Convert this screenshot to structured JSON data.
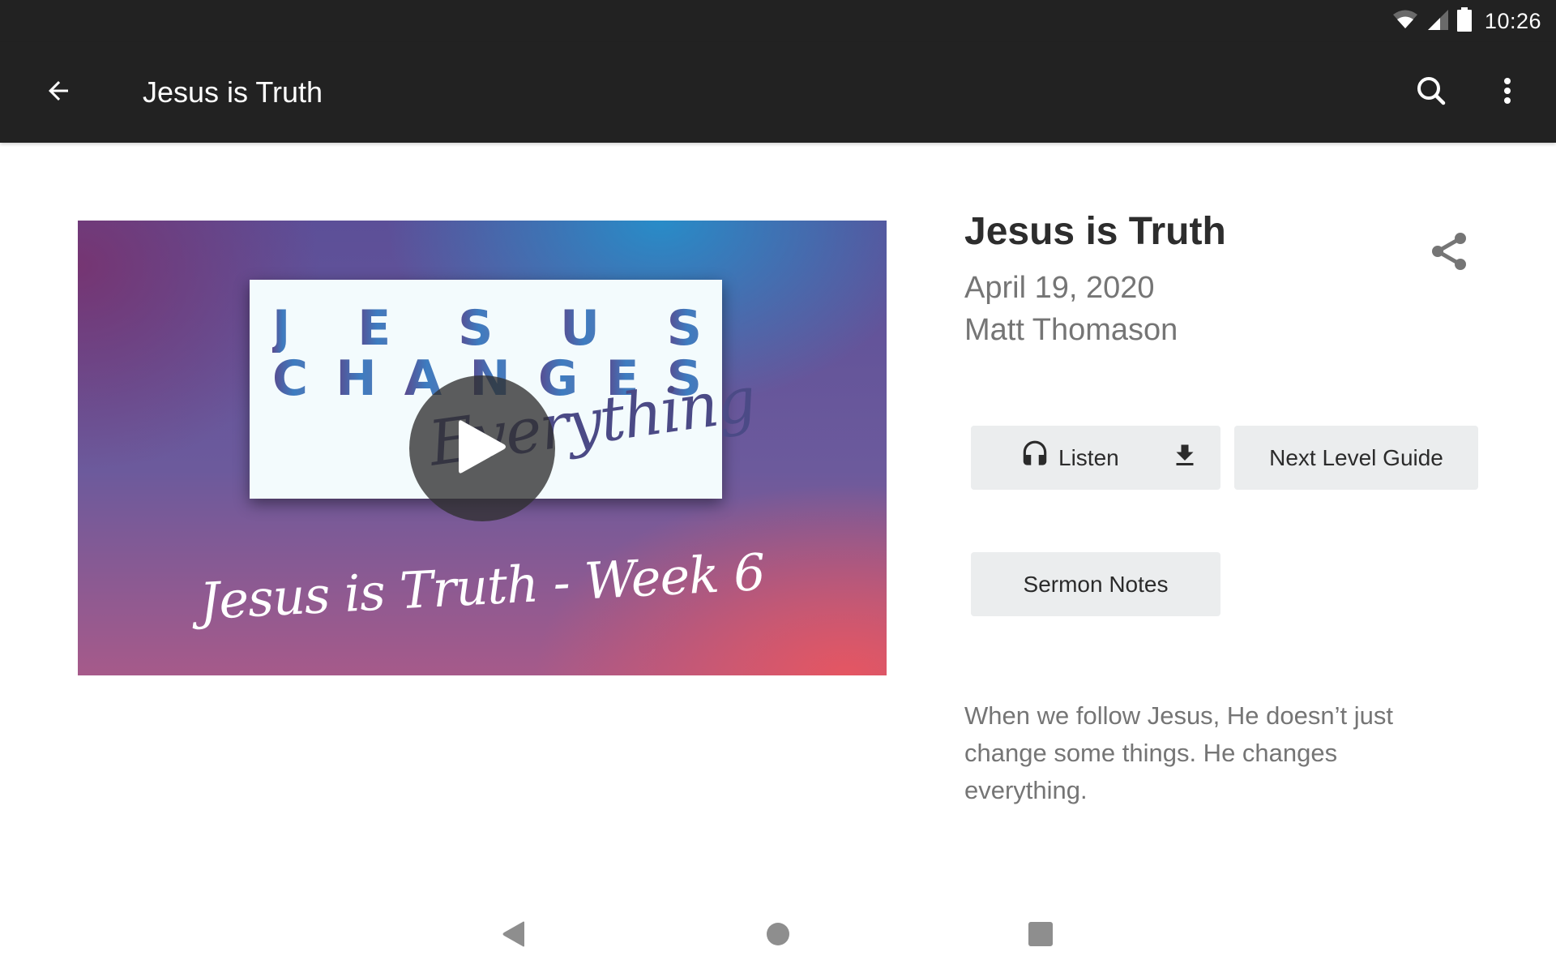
{
  "status_bar": {
    "time": "10:26",
    "icons": [
      "wifi-icon",
      "cell-signal-icon",
      "battery-icon"
    ]
  },
  "toolbar": {
    "title": "Jesus is Truth",
    "back_icon": "arrow-left-icon",
    "search_icon": "search-icon",
    "more_icon": "more-vert-icon"
  },
  "thumbnail": {
    "line1": [
      "J",
      "E",
      "S",
      "U",
      "S"
    ],
    "line2": [
      "C",
      "H",
      "A",
      "N",
      "G",
      "E",
      "S"
    ],
    "script": "Everything",
    "caption": "Jesus is Truth - Week 6",
    "play_icon": "play-icon"
  },
  "sermon": {
    "title": "Jesus is Truth",
    "date": "April 19, 2020",
    "speaker": "Matt Thomason",
    "share_icon": "share-icon",
    "description": "When we follow Jesus, He doesn’t just change some things. He changes everything."
  },
  "buttons": {
    "listen": "Listen",
    "next_level_guide": "Next Level Guide",
    "sermon_notes": "Sermon Notes"
  },
  "nav_bar": {
    "back": "nav-back-icon",
    "home": "nav-home-icon",
    "recents": "nav-recents-icon"
  },
  "colors": {
    "app_bar": "#222222",
    "button_bg": "#ebedee",
    "title_text": "#2d2d2d",
    "secondary_text": "#757575",
    "nav_icon": "#8e8e8e"
  }
}
